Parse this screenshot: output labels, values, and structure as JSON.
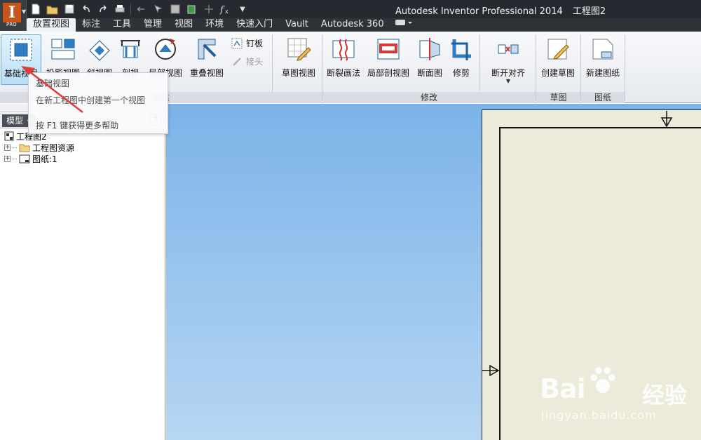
{
  "app": {
    "title": "Autodesk Inventor Professional 2014",
    "document": "工程图2",
    "edition_badge": "PRO"
  },
  "quick_access": [
    "new-icon",
    "open-icon",
    "save-icon",
    "undo-icon",
    "redo-icon",
    "print-icon",
    "return-icon",
    "select-icon",
    "update-icon",
    "material-icon",
    "plus-icon",
    "fx-icon"
  ],
  "tabs": [
    "放置视图",
    "标注",
    "工具",
    "管理",
    "视图",
    "环境",
    "快速入门",
    "Vault",
    "Autodesk 360"
  ],
  "ribbon": {
    "create": {
      "label": "创建",
      "buttons": [
        "基础视图",
        "投影视图",
        "斜视图",
        "剖视",
        "局部视图",
        "重叠视图"
      ],
      "small": [
        "钉板",
        "接头"
      ]
    },
    "sketch_view": {
      "label": "草图视图"
    },
    "modify": {
      "label": "修改",
      "buttons": [
        "断裂画法",
        "局部剖视图",
        "断面图",
        "修剪",
        "断开对齐"
      ]
    },
    "sketch": {
      "label": "草图",
      "buttons": [
        "创建草图"
      ]
    },
    "sheet": {
      "label": "图纸",
      "buttons": [
        "新建图纸"
      ]
    }
  },
  "tooltip": {
    "title": "基础视图",
    "description": "在新工程图中创建第一个视图",
    "help": "按 F1 键获得更多帮助"
  },
  "browser": {
    "mode": "模型",
    "help": "?",
    "close": "×",
    "tree": [
      {
        "label": "工程图2",
        "level": 0
      },
      {
        "label": "工程图资源",
        "level": 1
      },
      {
        "label": "图纸:1",
        "level": 1
      }
    ]
  },
  "watermark": {
    "brand": "Bai",
    "cn": "经验",
    "url": "jingyan.baidu.com"
  },
  "colors": {
    "canvas_top": "#7bb3e8",
    "canvas_bottom": "#b7d6f3",
    "sheet": "#ecebd9",
    "arrow": "#e03a3a"
  }
}
